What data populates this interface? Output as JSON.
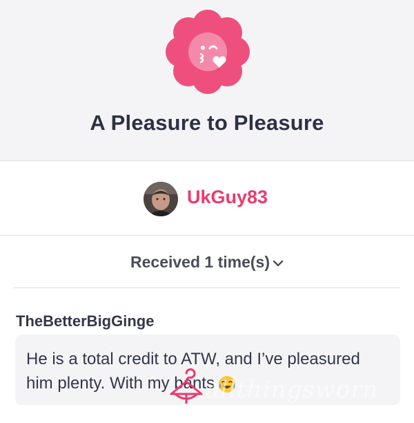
{
  "badge": {
    "icon": "kissing-face-flower-badge-icon",
    "color": "#ef4f7c"
  },
  "title": "A Pleasure to Pleasure",
  "user": {
    "name": "UkGuy83",
    "avatar": "user-avatar-photo"
  },
  "received": {
    "label": "Received 1 time(s)",
    "icon": "chevron-down-icon"
  },
  "review": {
    "author": "TheBetterBigGinge",
    "text": "He is a total credit to ATW, and I’ve pleasured him plenty. With my bants",
    "emoji": "crying-laughing-emoji-icon"
  },
  "watermark": {
    "logo": "hanger-logo-icon",
    "text": "allthingsworn"
  },
  "colors": {
    "accent": "#ec3b6e",
    "header_bg": "#f4f4f6",
    "text": "#2d3146"
  }
}
